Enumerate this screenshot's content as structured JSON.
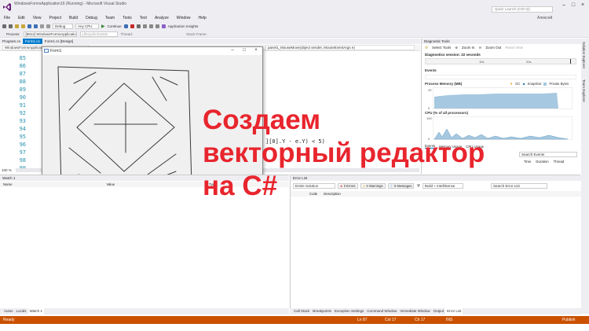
{
  "window": {
    "title": "WindowsFormsApplication16 (Running) - Microsoft Visual Studio",
    "quick_launch_placeholder": "Quick Launch (Ctrl+Q)",
    "user": "Алексей"
  },
  "menu": [
    "File",
    "Edit",
    "View",
    "Project",
    "Build",
    "Debug",
    "Team",
    "Tools",
    "Test",
    "Analyze",
    "Window",
    "Help"
  ],
  "toolbar": {
    "continue_label": "Continue",
    "config": "Debug",
    "platform": "Any CPU",
    "app_insights": "Application Insights"
  },
  "debugbar": {
    "process_label": "Process:",
    "process_value": "[8912] WindowsFormsApplication",
    "lifecycle_label": "Lifecycle Events",
    "thread_label": "Thread:",
    "stack_label": "Stack Frame:"
  },
  "editor": {
    "tabs": [
      "Program.cs",
      "Form1.cs",
      "Form1.cs [Design]"
    ],
    "nav_left": "WindowsFormsApplication16",
    "nav_right": "panel1_MouseMove(object sender, MouseEventArgs e)",
    "line_numbers": [
      "85",
      "86",
      "87",
      "88",
      "89",
      "90",
      "91",
      "92",
      "93",
      "94",
      "95",
      "96",
      "97",
      "98",
      "99"
    ],
    "code_fragment": "][0].Y - e.Y) < 5)",
    "zoom": "100 %"
  },
  "form": {
    "title": "Form1"
  },
  "overlay": {
    "lines": [
      "Создаем",
      "векторный редактор",
      "на C#"
    ]
  },
  "diagnostics": {
    "title": "Diagnostic Tools",
    "select_tools": "Select Tools",
    "zoom_in": "Zoom In",
    "zoom_out": "Zoom Out",
    "reset_view": "Reset View",
    "session": "Diagnostics session: 22 seconds",
    "timeline_ticks": [
      "10s",
      "20s"
    ],
    "events_title": "Events",
    "memory_title": "Process Memory (MB)",
    "memory_legend": [
      "GC",
      "Snapshot",
      "Private Bytes"
    ],
    "memory_axis": [
      "20",
      "0"
    ],
    "cpu_title": "CPU (% of all processors)",
    "cpu_axis": [
      "100",
      "0"
    ],
    "tabs": [
      "Events",
      "Memory Usage",
      "CPU Usage"
    ],
    "search_placeholder": "Search Events",
    "columns": [
      "Time",
      "Duration",
      "Thread"
    ]
  },
  "watch": {
    "title": "Watch 1",
    "columns": [
      "Name",
      "Value",
      "Type"
    ]
  },
  "errors": {
    "title": "Error List",
    "scope": "Entire Solution",
    "errors_btn": "0 Errors",
    "warnings_btn": "0 Warnings",
    "messages_btn": "0 Messages",
    "build_filter": "Build + IntelliSense",
    "search_placeholder": "Search Error List",
    "columns": [
      "Code",
      "Description"
    ]
  },
  "bottom_tabs_left": [
    "Autos",
    "Locals",
    "Watch 1"
  ],
  "bottom_tabs_right": [
    "Call Stack",
    "Breakpoints",
    "Exception Settings",
    "Command Window",
    "Immediate Window",
    "Output",
    "Error List"
  ],
  "side_tabs": [
    "Solution Explorer",
    "Team Explorer"
  ],
  "status": {
    "left": "Ready",
    "ln": "Ln 87",
    "col": "Col 17",
    "ch": "Ch 17",
    "mode": "INS",
    "publish": "Publish"
  },
  "colors": {
    "accent": "#007acc",
    "status_bar": "#ca5100",
    "overlay_text": "#e8252d",
    "memory_fill": "#a6c8e0"
  }
}
